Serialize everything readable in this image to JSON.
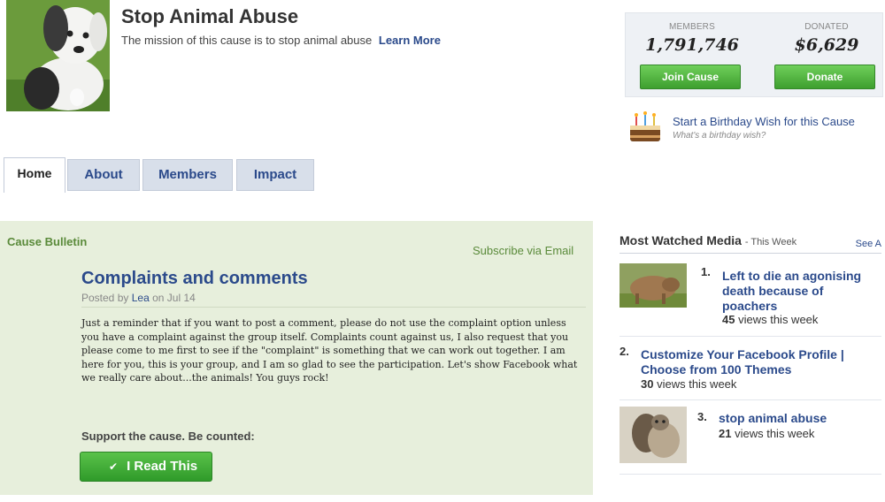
{
  "header": {
    "title": "Stop Animal Abuse",
    "mission": "The mission of this cause is to stop animal abuse",
    "learn_more": "Learn More"
  },
  "stats": {
    "members_label": "MEMBERS",
    "members_value": "1,791,746",
    "donated_label": "DONATED",
    "donated_value": "$6,629",
    "join_label": "Join Cause",
    "donate_label": "Donate"
  },
  "birthday": {
    "title": "Start a Birthday Wish for this Cause",
    "subtitle": "What's a birthday wish?"
  },
  "tabs": [
    {
      "label": "Home"
    },
    {
      "label": "About"
    },
    {
      "label": "Members"
    },
    {
      "label": "Impact"
    }
  ],
  "bulletin": {
    "heading": "Cause Bulletin",
    "subscribe": "Subscribe via Email",
    "post_title": "Complaints and comments",
    "posted_prefix": "Posted by",
    "author": "Lea",
    "date": "on Jul 14",
    "body": "Just a reminder that if you want to post a comment, please do not use the complaint option unless you have a complaint against the group itself. Complaints count against us, I also request that you please come to me first to see if the \"complaint\" is something that we can work out together. I am here for you, this is your group, and I am so glad to see the participation. Let's show Facebook what we really care about...the animals! You guys rock!",
    "support_text": "Support the cause. Be counted:",
    "read_button": "I Read This"
  },
  "media": {
    "heading": "Most Watched Media",
    "period": "- This Week",
    "see_all": "See A",
    "items": [
      {
        "num": "1.",
        "title": "Left to die an agonising death because of poachers",
        "views_count": "45",
        "views_text": "views this week"
      },
      {
        "num": "2.",
        "title": "Customize Your Facebook Profile | Choose from 100 Themes",
        "views_count": "30",
        "views_text": "views this week"
      },
      {
        "num": "3.",
        "title": "stop animal abuse",
        "views_count": "21",
        "views_text": "views this week"
      }
    ]
  }
}
